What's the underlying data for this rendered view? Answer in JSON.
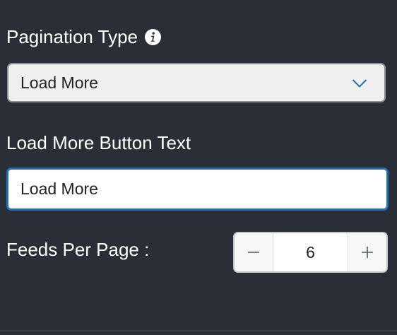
{
  "pagination": {
    "label": "Pagination Type",
    "info_icon": "info-icon",
    "selected": "Load More"
  },
  "button_text": {
    "label": "Load More Button Text",
    "value": "Load More"
  },
  "feeds_per_page": {
    "label": "Feeds Per Page :",
    "value": "6",
    "decrement_icon": "minus-icon",
    "increment_icon": "plus-icon"
  },
  "colors": {
    "background": "#2a2e37",
    "focus_border": "#2271b1",
    "chevron": "#2271b1"
  }
}
